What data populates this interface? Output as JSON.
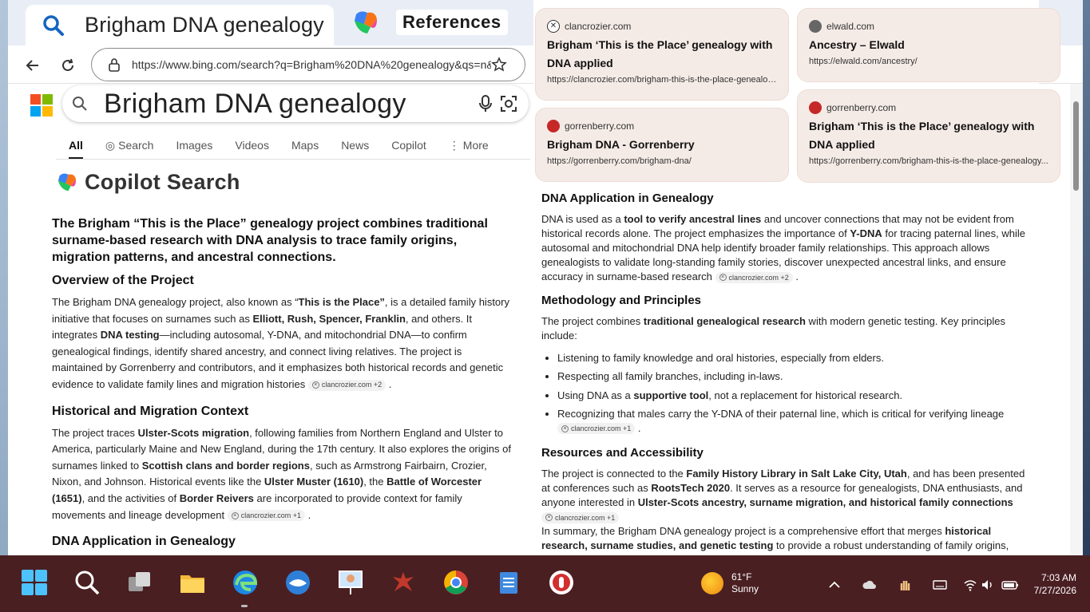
{
  "browser": {
    "tab_title": "Brigham DNA genealogy",
    "tab3_label": "References",
    "address": "https://www.bing.com/search?q=Brigham%20DNA%20genealogy&qs=n&"
  },
  "search": {
    "query": "Brigham DNA genealogy",
    "tabs": [
      "All",
      "Search",
      "Images",
      "Videos",
      "Maps",
      "News",
      "Copilot",
      "More"
    ]
  },
  "copilot": {
    "title": "Copilot Search"
  },
  "left": {
    "lead": "The Brigham “This is the Place” genealogy project combines traditional surname-based research with DNA analysis to trace family origins, migration patterns, and ancestral connections.",
    "h_overview": "Overview of the Project",
    "p_overview_1": "The Brigham DNA genealogy project, also known as “",
    "p_overview_b1": "This is the Place”",
    "p_overview_2": ", is a detailed family history initiative that focuses on surnames such as ",
    "p_overview_b2": "Elliott, Rush, Spencer, Franklin",
    "p_overview_3": ", and others. It integrates ",
    "p_overview_b3": "DNA testing",
    "p_overview_4": "—including autosomal, Y-DNA, and mitochondrial DNA—to confirm genealogical findings, identify shared ancestry, and connect living relatives. The project is maintained by Gorrenberry and contributors, and it emphasizes both historical records and genetic evidence to validate family lines and migration histories",
    "cite_overview": "clancrozier.com +2",
    "h_history": "Historical and Migration Context",
    "p_hist_1": "The project traces ",
    "p_hist_b1": "Ulster-Scots migration",
    "p_hist_2": ", following families from Northern England and Ulster to America, particularly Maine and New England, during the 17th century. It also explores the origins of surnames linked to ",
    "p_hist_b2": "Scottish clans and border regions",
    "p_hist_3": ", such as Armstrong Fairbairn, Crozier, Nixon, and Johnson. Historical events like the ",
    "p_hist_b3": "Ulster Muster (1610)",
    "p_hist_4": ", the ",
    "p_hist_b4": "Battle of Worcester (1651)",
    "p_hist_5": ", and the activities of ",
    "p_hist_b5": "Border Reivers",
    "p_hist_6": " are incorporated to provide context for family movements and lineage development",
    "cite_hist": "clancrozier.com +1",
    "h_dna": "DNA Application in Genealogy"
  },
  "cards": [
    {
      "domain": "clancrozier.com",
      "title": "Brigham ‘This is the Place’ genealogy with DNA applied",
      "url": "https://clancrozier.com/brigham-this-is-the-place-genealogy-..."
    },
    {
      "domain": "elwald.com",
      "title": "Ancestry – Elwald",
      "url": "https://elwald.com/ancestry/"
    },
    {
      "domain": "gorrenberry.com",
      "title": "Brigham DNA - Gorrenberry",
      "url": "https://gorrenberry.com/brigham-dna/"
    },
    {
      "domain": "gorrenberry.com",
      "title": "Brigham ‘This is the Place’ genealogy with DNA applied",
      "url": "https://gorrenberry.com/brigham-this-is-the-place-genealogy..."
    }
  ],
  "right": {
    "h_dna": "DNA Application in Genealogy",
    "p_dna_1": "DNA is used as a ",
    "p_dna_b1": "tool to verify ancestral lines",
    "p_dna_2": " and uncover connections that may not be evident from historical records alone. The project emphasizes the importance of ",
    "p_dna_b2": "Y-DNA",
    "p_dna_3": " for tracing paternal lines, while autosomal and mitochondrial DNA help identify broader family relationships. This approach allows genealogists to validate long-standing family stories, discover unexpected ancestral links, and ensure accuracy in surname-based research",
    "cite_dna": "clancrozier.com +2",
    "h_method": "Methodology and Principles",
    "p_method_1": "The project combines ",
    "p_method_b1": "traditional genealogical research",
    "p_method_2": " with modern genetic testing. Key principles include:",
    "li1": "Listening to family knowledge and oral histories, especially from elders.",
    "li2": "Respecting all family branches, including in-laws.",
    "li3_1": "Using DNA as a ",
    "li3_b": "supportive tool",
    "li3_2": ", not a replacement for historical research.",
    "li4": "Recognizing that males carry the Y-DNA of their paternal line, which is critical for verifying lineage",
    "cite_li4": "clancrozier.com +1",
    "h_res": "Resources and Accessibility",
    "p_res_1": "The project is connected to the ",
    "p_res_b1": "Family History Library in Salt Lake City, Utah",
    "p_res_2": ", and has been presented at conferences such as ",
    "p_res_b2": "RootsTech 2020",
    "p_res_3": ". It serves as a resource for genealogists, DNA enthusiasts, and anyone interested in ",
    "p_res_b3": "Ulster-Scots ancestry, surname migration, and historical family connections",
    "cite_res": "clancrozier.com +1",
    "p_sum_1": "In summary, the Brigham DNA genealogy project is a comprehensive effort that merges ",
    "p_sum_b1": "historical research, surname studies, and genetic testing",
    "p_sum_2": " to provide a robust understanding of family origins, migrations, and connections across generations."
  },
  "taskbar": {
    "weather_temp": "61°F",
    "weather_desc": "Sunny",
    "time": "7:03 AM",
    "date": "7/27/2026"
  },
  "colors": {
    "taskbar": "#4a1f22",
    "card_bg": "#f5ebe6",
    "accent": "#1a73e8"
  }
}
